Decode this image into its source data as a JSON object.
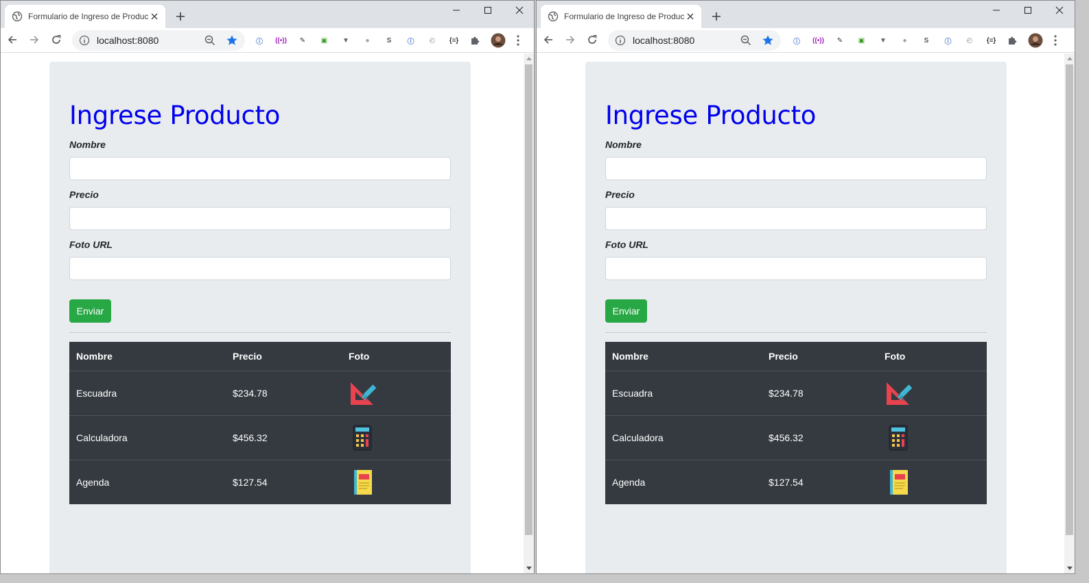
{
  "browser": {
    "tab_title": "Formulario de Ingreso de Produc",
    "url": "localhost:8080",
    "icons": [
      "globe-icon",
      "close-icon",
      "plus-icon",
      "minimize-icon",
      "maximize-icon",
      "window-close-icon",
      "back-arrow-icon",
      "forward-arrow-icon",
      "reload-icon",
      "info-icon",
      "zoom-out-icon",
      "star-icon",
      "puzzle-icon",
      "profile-avatar",
      "kebab-menu-icon"
    ],
    "extensions": [
      {
        "name": "opera-ext-icon",
        "glyph": "ⓘ",
        "color": "#4a7bd0"
      },
      {
        "name": "broadcast-ext-icon",
        "glyph": "((•))",
        "color": "#a020c0"
      },
      {
        "name": "eyedropper-ext-icon",
        "glyph": "✎",
        "color": "#333333"
      },
      {
        "name": "green-square-ext-icon",
        "glyph": "▣",
        "color": "#3a9d23"
      },
      {
        "name": "vue-ext-icon",
        "glyph": "▼",
        "color": "#606060"
      },
      {
        "name": "bubble-ext-icon",
        "glyph": "●",
        "color": "#9aa0a6"
      },
      {
        "name": "s-ext-icon",
        "glyph": "S",
        "color": "#555555"
      },
      {
        "name": "opera2-ext-icon",
        "glyph": "ⓘ",
        "color": "#4a7bd0"
      },
      {
        "name": "clock-ext-icon",
        "glyph": "◴",
        "color": "#888888"
      },
      {
        "name": "braces-ext-icon",
        "glyph": "{≡}",
        "color": "#333333"
      }
    ]
  },
  "form": {
    "title": "Ingrese Producto",
    "fields": [
      {
        "label": "Nombre",
        "value": ""
      },
      {
        "label": "Precio",
        "value": ""
      },
      {
        "label": "Foto URL",
        "value": ""
      }
    ],
    "submit_label": "Enviar"
  },
  "table": {
    "headers": [
      "Nombre",
      "Precio",
      "Foto"
    ],
    "rows": [
      {
        "name": "Escuadra",
        "price": "$234.78",
        "icon": "set-square-icon"
      },
      {
        "name": "Calculadora",
        "price": "$456.32",
        "icon": "calculator-icon"
      },
      {
        "name": "Agenda",
        "price": "$127.54",
        "icon": "notebook-icon"
      }
    ]
  },
  "colors": {
    "title": "#0000ee",
    "submit": "#28a745",
    "table_bg": "#343a40",
    "jumbotron_bg": "#e9ecef"
  }
}
